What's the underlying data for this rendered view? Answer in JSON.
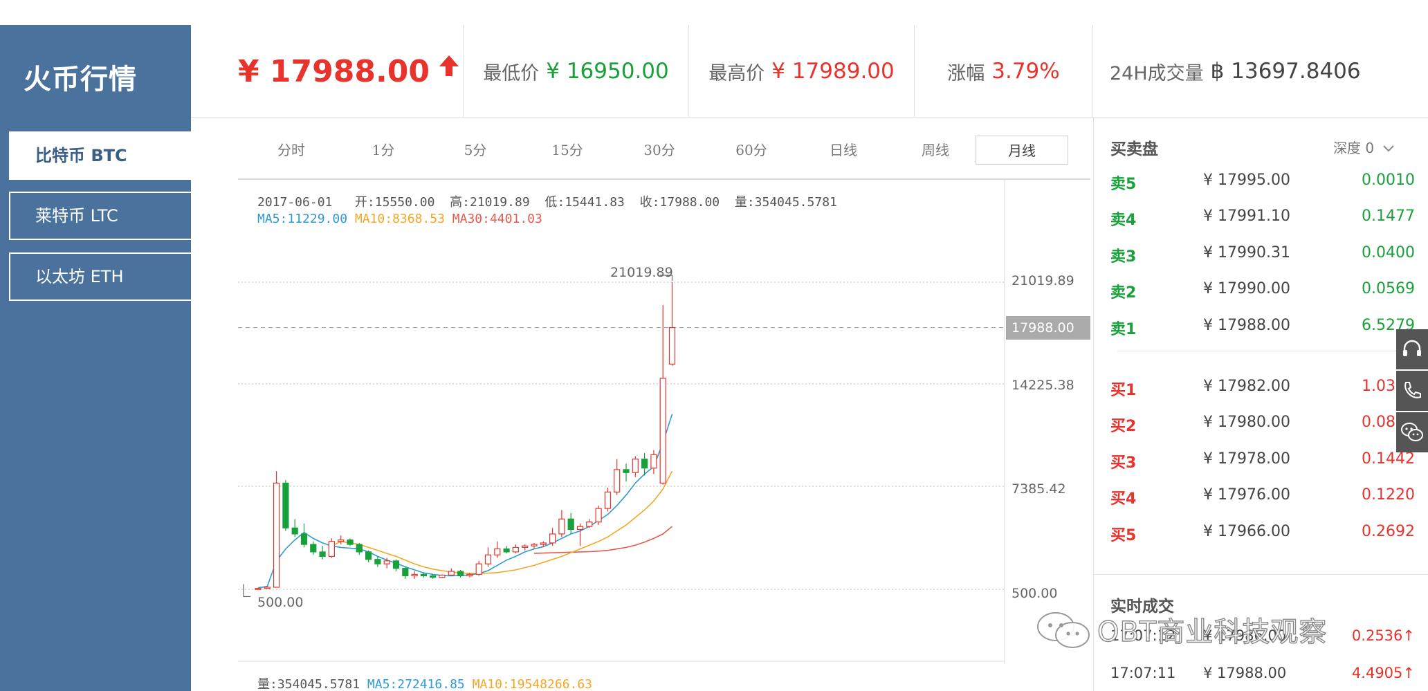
{
  "sidebar": {
    "title": "火币行情",
    "items": [
      {
        "label": "比特币 BTC",
        "active": true
      },
      {
        "label": "莱特币 LTC",
        "active": false
      },
      {
        "label": "以太坊 ETH",
        "active": false
      }
    ]
  },
  "ticker": {
    "price": "¥ 17988.00",
    "low_label": "最低价",
    "low_value": "¥ 16950.00",
    "high_label": "最高价",
    "high_value": "¥ 17989.00",
    "change_label": "涨幅",
    "change_value": "3.79%",
    "volume_label": "24H成交量",
    "volume_value": "฿ 13697.8406"
  },
  "periods": [
    "分时",
    "1分",
    "5分",
    "15分",
    "30分",
    "60分",
    "日线",
    "周线",
    "月线"
  ],
  "active_period": "月线",
  "chart": {
    "info": {
      "date": "2017-06-01",
      "open": "开:15550.00",
      "high": "高:21019.89",
      "low": "低:15441.83",
      "close": "收:17988.00",
      "vol": "量:354045.5781"
    },
    "ma": {
      "ma5": "MA5:11229.00",
      "ma10": "MA10:8368.53",
      "ma30": "MA30:4401.03"
    },
    "scale_labels": [
      "21019.89",
      "14225.38",
      "7385.42",
      "500.00"
    ],
    "current_price_tag": "17988.00",
    "max_marker": "21019.89",
    "min_marker": "500.00",
    "volume_line": {
      "vol": "量:354045.5781",
      "ma5": "MA5:272416.85",
      "ma10": "MA10:19548266.63"
    },
    "colors": {
      "up": "#e8322c",
      "down": "#18a03a",
      "ma5": "#2d9ad6",
      "ma10": "#f5a623",
      "ma30": "#e55b50"
    }
  },
  "chart_data": {
    "type": "candlestick",
    "ylim": [
      500,
      21019.89
    ],
    "series_candles": [
      {
        "o": 520,
        "h": 600,
        "l": 480,
        "c": 560
      },
      {
        "o": 560,
        "h": 700,
        "l": 540,
        "c": 640
      },
      {
        "o": 640,
        "h": 8400,
        "l": 620,
        "c": 7600
      },
      {
        "o": 7600,
        "h": 7800,
        "l": 4400,
        "c": 4600
      },
      {
        "o": 4600,
        "h": 5200,
        "l": 4000,
        "c": 4200
      },
      {
        "o": 4200,
        "h": 4900,
        "l": 3300,
        "c": 3500
      },
      {
        "o": 3500,
        "h": 3700,
        "l": 2800,
        "c": 3000
      },
      {
        "o": 3000,
        "h": 3400,
        "l": 2500,
        "c": 2700
      },
      {
        "o": 2700,
        "h": 3900,
        "l": 2600,
        "c": 3700
      },
      {
        "o": 3700,
        "h": 4100,
        "l": 3500,
        "c": 3800
      },
      {
        "o": 3800,
        "h": 3900,
        "l": 3400,
        "c": 3500
      },
      {
        "o": 3500,
        "h": 3600,
        "l": 2800,
        "c": 3000
      },
      {
        "o": 3000,
        "h": 3100,
        "l": 2300,
        "c": 2500
      },
      {
        "o": 2500,
        "h": 2700,
        "l": 2000,
        "c": 2200
      },
      {
        "o": 2200,
        "h": 2600,
        "l": 1900,
        "c": 2400
      },
      {
        "o": 2400,
        "h": 2500,
        "l": 1700,
        "c": 1900
      },
      {
        "o": 1900,
        "h": 2000,
        "l": 1200,
        "c": 1400
      },
      {
        "o": 1400,
        "h": 1700,
        "l": 1200,
        "c": 1500
      },
      {
        "o": 1500,
        "h": 1600,
        "l": 1300,
        "c": 1400
      },
      {
        "o": 1400,
        "h": 1500,
        "l": 1200,
        "c": 1300
      },
      {
        "o": 1300,
        "h": 1500,
        "l": 1250,
        "c": 1450
      },
      {
        "o": 1450,
        "h": 1900,
        "l": 1400,
        "c": 1700
      },
      {
        "o": 1700,
        "h": 1800,
        "l": 1300,
        "c": 1400
      },
      {
        "o": 1400,
        "h": 1600,
        "l": 1300,
        "c": 1500
      },
      {
        "o": 1500,
        "h": 2400,
        "l": 1400,
        "c": 2200
      },
      {
        "o": 2200,
        "h": 3300,
        "l": 2000,
        "c": 2800
      },
      {
        "o": 2800,
        "h": 3700,
        "l": 2600,
        "c": 3200
      },
      {
        "o": 3200,
        "h": 3400,
        "l": 2900,
        "c": 3000
      },
      {
        "o": 3000,
        "h": 3500,
        "l": 2900,
        "c": 3300
      },
      {
        "o": 3300,
        "h": 3500,
        "l": 3100,
        "c": 3400
      },
      {
        "o": 3400,
        "h": 3600,
        "l": 3200,
        "c": 3500
      },
      {
        "o": 3500,
        "h": 3700,
        "l": 3300,
        "c": 3600
      },
      {
        "o": 3600,
        "h": 4600,
        "l": 3400,
        "c": 4200
      },
      {
        "o": 4200,
        "h": 5800,
        "l": 4000,
        "c": 5200
      },
      {
        "o": 5200,
        "h": 5600,
        "l": 4200,
        "c": 4500
      },
      {
        "o": 4500,
        "h": 4900,
        "l": 3400,
        "c": 4700
      },
      {
        "o": 4700,
        "h": 5200,
        "l": 4600,
        "c": 5000
      },
      {
        "o": 5000,
        "h": 6100,
        "l": 4800,
        "c": 5900
      },
      {
        "o": 5900,
        "h": 7300,
        "l": 5700,
        "c": 7000
      },
      {
        "o": 7000,
        "h": 9200,
        "l": 6800,
        "c": 8500
      },
      {
        "o": 8500,
        "h": 8900,
        "l": 7700,
        "c": 8300
      },
      {
        "o": 8300,
        "h": 9400,
        "l": 8000,
        "c": 9200
      },
      {
        "o": 9200,
        "h": 9600,
        "l": 8100,
        "c": 8600
      },
      {
        "o": 8600,
        "h": 9800,
        "l": 8200,
        "c": 9500
      },
      {
        "o": 7600,
        "h": 19500,
        "l": 7500,
        "c": 14600
      },
      {
        "o": 15550,
        "h": 21019.89,
        "l": 15441.83,
        "c": 17988
      }
    ],
    "ma5": [
      600,
      700,
      2400,
      3200,
      3800,
      4300,
      3900,
      3600,
      3400,
      3300,
      3250,
      3200,
      3000,
      2700,
      2450,
      2250,
      2000,
      1800,
      1600,
      1500,
      1420,
      1400,
      1420,
      1460,
      1560,
      1750,
      2100,
      2450,
      2700,
      3000,
      3200,
      3350,
      3600,
      3900,
      4200,
      4400,
      4700,
      5100,
      5500,
      6100,
      6800,
      7600,
      8200,
      8700,
      10300,
      12200
    ],
    "ma10": [
      null,
      null,
      null,
      null,
      null,
      null,
      null,
      null,
      3400,
      3700,
      3600,
      3500,
      3300,
      3100,
      2900,
      2700,
      2450,
      2200,
      2000,
      1850,
      1750,
      1650,
      1600,
      1560,
      1560,
      1580,
      1620,
      1700,
      1800,
      1950,
      2100,
      2300,
      2500,
      2700,
      2950,
      3200,
      3450,
      3700,
      4000,
      4400,
      4800,
      5300,
      5800,
      6400,
      7200,
      8400
    ],
    "ma30": [
      null,
      null,
      null,
      null,
      null,
      null,
      null,
      null,
      null,
      null,
      null,
      null,
      null,
      null,
      null,
      null,
      null,
      null,
      null,
      null,
      null,
      null,
      null,
      null,
      null,
      null,
      null,
      null,
      null,
      null,
      2900,
      2920,
      2940,
      2960,
      2980,
      3000,
      3020,
      3050,
      3100,
      3200,
      3300,
      3450,
      3650,
      3900,
      4200,
      4700
    ]
  },
  "order_book": {
    "title": "买卖盘",
    "depth_label": "深度 0",
    "asks": [
      {
        "side": "卖5",
        "price": "¥ 17995.00",
        "qty": "0.0010"
      },
      {
        "side": "卖4",
        "price": "¥ 17991.10",
        "qty": "0.1477"
      },
      {
        "side": "卖3",
        "price": "¥ 17990.31",
        "qty": "0.0400"
      },
      {
        "side": "卖2",
        "price": "¥ 17990.00",
        "qty": "0.0569"
      },
      {
        "side": "卖1",
        "price": "¥ 17988.00",
        "qty": "6.5279"
      }
    ],
    "bids": [
      {
        "side": "买1",
        "price": "¥ 17982.00",
        "qty": "1.0337"
      },
      {
        "side": "买2",
        "price": "¥ 17980.00",
        "qty": "0.0842"
      },
      {
        "side": "买3",
        "price": "¥ 17978.00",
        "qty": "0.1442"
      },
      {
        "side": "买4",
        "price": "¥ 17976.00",
        "qty": "0.1220"
      },
      {
        "side": "买5",
        "price": "¥ 17966.00",
        "qty": "0.2692"
      }
    ]
  },
  "trades": {
    "title": "实时成交",
    "rows": [
      {
        "time": "17:07:12",
        "price": "¥ 17986.00",
        "qty": "0.2536↑"
      },
      {
        "time": "17:07:11",
        "price": "¥ 17988.00",
        "qty": "4.4905↑"
      }
    ]
  },
  "watermark": "OBT商业科技观察"
}
